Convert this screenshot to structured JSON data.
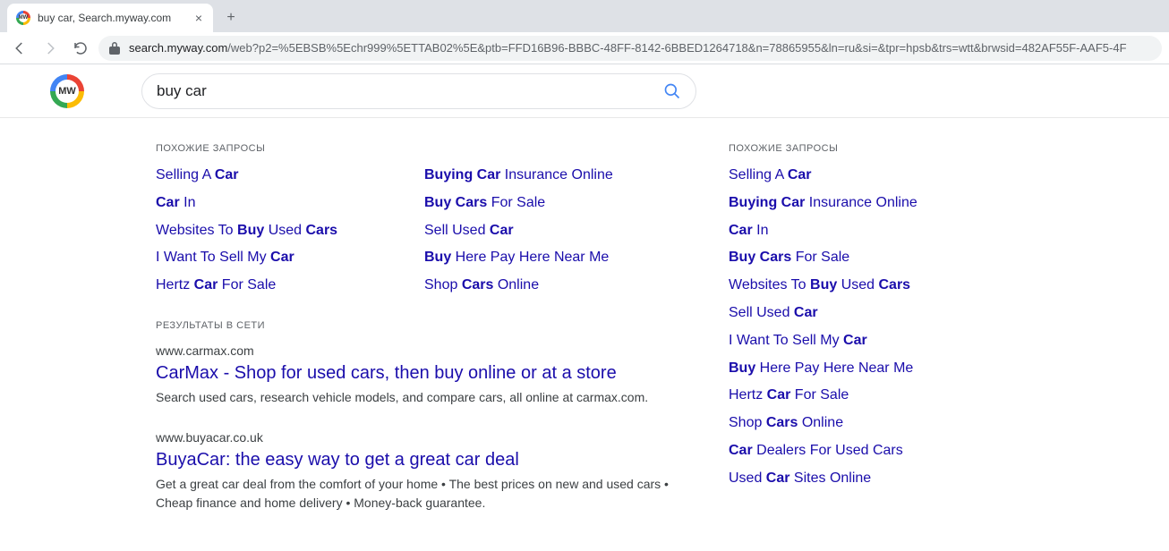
{
  "browser": {
    "tab_title": "buy car, Search.myway.com",
    "url_host": "search.myway.com",
    "url_path": "/web?p2=%5EBSB%5Echr999%5ETTAB02%5E&ptb=FFD16B96-BBBC-48FF-8142-6BBED1264718&n=78865955&ln=ru&si=&tpr=hpsb&trs=wtt&brwsid=482AF55F-AAF5-4F"
  },
  "search": {
    "query": "buy car"
  },
  "labels": {
    "related": "ПОХОЖИЕ ЗАПРОСЫ",
    "web_results": "РЕЗУЛЬТАТЫ В СЕТИ"
  },
  "related_left": [
    {
      "html": "Selling A <b>Car</b>"
    },
    {
      "html": "<b>Car</b> In"
    },
    {
      "html": "Websites To <b>Buy</b> Used <b>Cars</b>"
    },
    {
      "html": "I Want To Sell My <b>Car</b>"
    },
    {
      "html": "Hertz <b>Car</b> For Sale"
    }
  ],
  "related_right": [
    {
      "html": "<b>Buying Car</b> Insurance Online"
    },
    {
      "html": "<b>Buy Cars</b> For Sale"
    },
    {
      "html": "Sell Used <b>Car</b>"
    },
    {
      "html": "<b>Buy</b> Here Pay Here Near Me"
    },
    {
      "html": "Shop <b>Cars</b> Online"
    }
  ],
  "sidebar_related": [
    {
      "html": "Selling A <b>Car</b>"
    },
    {
      "html": "<b>Buying Car</b> Insurance Online"
    },
    {
      "html": "<b>Car</b> In"
    },
    {
      "html": "<b>Buy Cars</b> For Sale"
    },
    {
      "html": "Websites To <b>Buy</b> Used <b>Cars</b>"
    },
    {
      "html": "Sell Used <b>Car</b>"
    },
    {
      "html": "I Want To Sell My <b>Car</b>"
    },
    {
      "html": "<b>Buy</b> Here Pay Here Near Me"
    },
    {
      "html": "Hertz <b>Car</b> For Sale"
    },
    {
      "html": "Shop <b>Cars</b> Online"
    },
    {
      "html": "<b>Car</b> Dealers For Used Cars"
    },
    {
      "html": "Used <b>Car</b> Sites Online"
    }
  ],
  "results": [
    {
      "url": "www.carmax.com",
      "title": "CarMax - Shop for used cars, then buy online or at a store",
      "snippet": "Search used cars, research vehicle models, and compare cars, all online at carmax.com."
    },
    {
      "url": "www.buyacar.co.uk",
      "title": "BuyaCar: the easy way to get a great car deal",
      "snippet": "Get a great car deal from the comfort of your home • The best prices on new and used cars • Cheap finance and home delivery • Money-back guarantee."
    }
  ]
}
